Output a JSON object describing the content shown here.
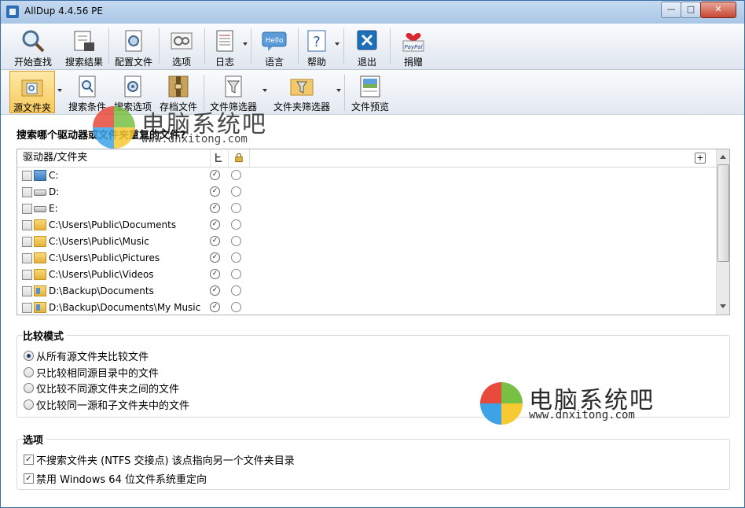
{
  "window": {
    "title": "AllDup 4.4.56 PE",
    "minimize": "—",
    "maximize": "□",
    "close": "✕"
  },
  "toolbar_main": [
    {
      "label": "开始查找",
      "icon": "magnifier-icon"
    },
    {
      "label": "搜索结果",
      "icon": "search-results-icon"
    },
    {
      "label": "配置文件",
      "icon": "profile-icon"
    },
    {
      "label": "选项",
      "icon": "options-icon"
    },
    {
      "label": "日志",
      "icon": "log-icon"
    },
    {
      "label": "语言",
      "icon": "language-hello-icon"
    },
    {
      "label": "帮助",
      "icon": "help-icon"
    },
    {
      "label": "退出",
      "icon": "exit-icon"
    },
    {
      "label": "捐赠",
      "icon": "paypal-donate-icon"
    }
  ],
  "toolbar_tabs": [
    {
      "label": "源文件夹",
      "icon": "source-folder-icon",
      "active": true
    },
    {
      "label": "搜索条件",
      "icon": "search-criteria-icon"
    },
    {
      "label": "搜索选项",
      "icon": "search-options-icon"
    },
    {
      "label": "存档文件",
      "icon": "archive-icon"
    },
    {
      "label": "文件筛选器",
      "icon": "file-filter-icon"
    },
    {
      "label": "文件夹筛选器",
      "icon": "folder-filter-icon"
    },
    {
      "label": "文件预览",
      "icon": "file-preview-icon"
    }
  ],
  "source": {
    "question": "搜索哪个驱动器或文件夹重复的文件?",
    "column_header": "驱动器/文件夹",
    "add_button": "+",
    "rows": [
      {
        "path": "C:",
        "icon": "system-drive-icon"
      },
      {
        "path": "D:",
        "icon": "drive-icon"
      },
      {
        "path": "E:",
        "icon": "drive-icon"
      },
      {
        "path": "C:\\Users\\Public\\Documents",
        "icon": "folder-icon"
      },
      {
        "path": "C:\\Users\\Public\\Music",
        "icon": "folder-icon"
      },
      {
        "path": "C:\\Users\\Public\\Pictures",
        "icon": "folder-icon"
      },
      {
        "path": "C:\\Users\\Public\\Videos",
        "icon": "folder-icon"
      },
      {
        "path": "D:\\Backup\\Documents",
        "icon": "library-folder-icon"
      },
      {
        "path": "D:\\Backup\\Documents\\My Music",
        "icon": "library-folder-icon"
      }
    ]
  },
  "compare": {
    "title": "比较模式",
    "options": [
      {
        "label": "从所有源文件夹比较文件",
        "selected": true
      },
      {
        "label": "只比较相同源目录中的文件",
        "selected": false
      },
      {
        "label": "仅比较不同源文件夹之间的文件",
        "selected": false
      },
      {
        "label": "仅比较同一源和子文件夹中的文件",
        "selected": false
      }
    ]
  },
  "options": {
    "title": "选项",
    "items": [
      {
        "label": "不搜索文件夹 (NTFS 交接点) 该点指向另一个文件夹目录",
        "checked": true
      },
      {
        "label": "禁用 Windows 64 位文件系统重定向",
        "checked": true
      }
    ]
  },
  "watermark": {
    "name": "电脑系统吧",
    "url": "www.dnxitong.com"
  },
  "colors": {
    "accent": "#f7c95b",
    "titlebar": "#b7cfea",
    "wm_red": "#e84a3c",
    "wm_green": "#78c043",
    "wm_blue": "#3ea3e6",
    "wm_yellow": "#f7c933"
  }
}
